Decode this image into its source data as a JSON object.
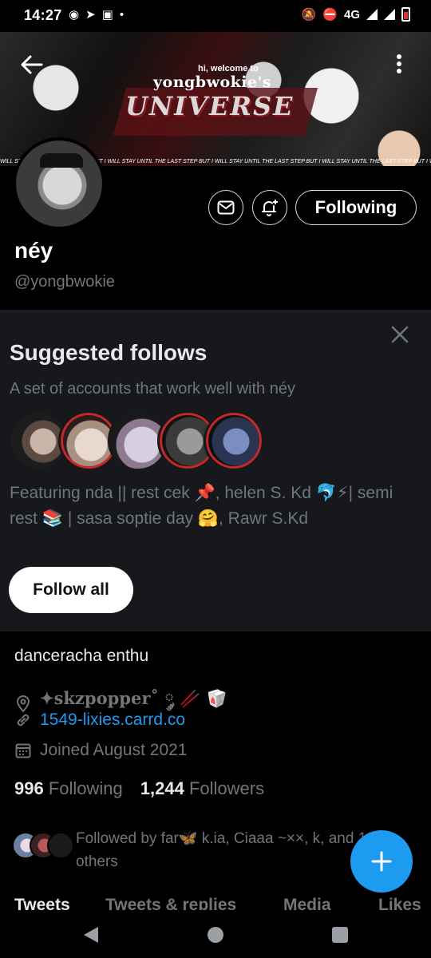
{
  "status_bar": {
    "time": "14:27",
    "network": "4G"
  },
  "banner": {
    "greeting": "hi, welcome to",
    "name": "yongbwokie's",
    "word": "UNIVERSE",
    "strip_text": "WILL STAY UNTIL THE LAST STEP BUT I WILL STAY UNTIL THE LAST STEP BUT I WILL STAY UNTIL THE LAST STEP BUT I WILL STAY UNTIL THE LAST STEP BUT I WILL STAY UNTIL THE LAST STEP BUT I WILL STAY UNTIL THE LAS"
  },
  "profile": {
    "display_name": "néy",
    "handle": "@yongbwokie",
    "following_button": "Following",
    "bio": "danceracha enthu",
    "location": "✦skzpopper˚ ༘ 🥢 🥡",
    "website": "1549-lixies.carrd.co",
    "joined": "Joined August 2021",
    "following_count": "996",
    "following_label": "Following",
    "followers_count": "1,244",
    "followers_label": "Followers",
    "followed_by": "Followed by far🦋 k.ia, Ciaaa ~××, k, and 11 others"
  },
  "suggested": {
    "title": "Suggested follows",
    "subtitle": "A set of accounts that work well with néy",
    "featuring": "Featuring nda || rest cek 📌, helen S. Kd 🐬⚡| semi rest 📚 | sasa soptie day 🤗, Rawr S.Kd",
    "follow_all": "Follow all"
  },
  "tabs": [
    {
      "label": "Tweets"
    },
    {
      "label": "Tweets & replies"
    },
    {
      "label": "Media"
    },
    {
      "label": "Likes"
    }
  ],
  "colors": {
    "accent": "#1d9bf0",
    "background": "#000000",
    "card": "#16181c",
    "muted": "#71767b"
  },
  "icons": {
    "back": "arrow-left-icon",
    "more": "more-vertical-icon",
    "message": "envelope-icon",
    "notify": "bell-plus-icon",
    "close": "close-icon",
    "location": "location-pin-icon",
    "link": "link-icon",
    "calendar": "calendar-icon",
    "compose": "plus-icon"
  }
}
